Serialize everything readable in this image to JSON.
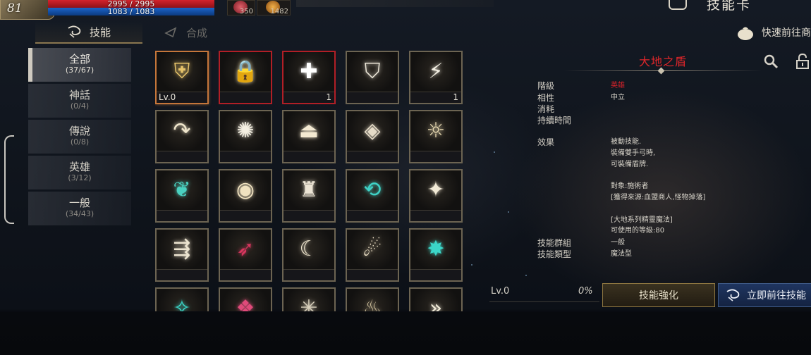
{
  "hud": {
    "level": "81",
    "hp_text": "2995 / 2995",
    "mp_text": "1083 / 1083",
    "potion_1_count": "350",
    "potion_2_count": "1482",
    "title": "技能卡"
  },
  "tabs": [
    {
      "label": "技能",
      "active": true
    },
    {
      "label": "合成",
      "active": false
    }
  ],
  "quick_link": "快速前往商",
  "categories": [
    {
      "name": "全部",
      "count": "(37/67)",
      "active": true
    },
    {
      "name": "神話",
      "count": "(0/4)",
      "active": false
    },
    {
      "name": "傳說",
      "count": "(0/8)",
      "active": false
    },
    {
      "name": "英雄",
      "count": "(3/12)",
      "active": false
    },
    {
      "name": "一般",
      "count": "(34/43)",
      "active": false
    }
  ],
  "skills": [
    {
      "icon": "shield-sword-icon",
      "glyph": "⛨",
      "color": "#e6c36a",
      "border": "selected",
      "lv": "Lv.0",
      "num": ""
    },
    {
      "icon": "lock-star-icon",
      "glyph": "🔒",
      "color": "#e8d8a8",
      "border": "red",
      "lv": "",
      "num": ""
    },
    {
      "icon": "swirl-plus-icon",
      "glyph": "✚",
      "color": "#ffffff",
      "border": "red",
      "lv": "",
      "num": "1"
    },
    {
      "icon": "shield-icon",
      "glyph": "⛉",
      "color": "#ece6d8",
      "border": "normal",
      "lv": "",
      "num": ""
    },
    {
      "icon": "lightning-icon",
      "glyph": "⚡",
      "color": "#f2eee2",
      "border": "normal",
      "lv": "",
      "num": "1"
    },
    {
      "icon": "curved-arrow-icon",
      "glyph": "↷",
      "color": "#f0e6cc",
      "border": "normal",
      "lv": "",
      "num": ""
    },
    {
      "icon": "burst-icon",
      "glyph": "✺",
      "color": "#f4efe2",
      "border": "normal",
      "lv": "",
      "num": ""
    },
    {
      "icon": "summon-circle-icon",
      "glyph": "⏏",
      "color": "#f4ead2",
      "border": "normal",
      "lv": "",
      "num": ""
    },
    {
      "icon": "eye-icon",
      "glyph": "◈",
      "color": "#e6dcc8",
      "border": "normal",
      "lv": "",
      "num": ""
    },
    {
      "icon": "wave-sun-icon",
      "glyph": "☼",
      "color": "#e6d8b0",
      "border": "normal",
      "lv": "",
      "num": ""
    },
    {
      "icon": "teal-leaf-icon",
      "glyph": "❦",
      "color": "#4ad1c0",
      "border": "normal",
      "lv": "",
      "num": ""
    },
    {
      "icon": "orb-icon",
      "glyph": "◉",
      "color": "#f0e2c0",
      "border": "normal",
      "lv": "",
      "num": ""
    },
    {
      "icon": "pillar-icon",
      "glyph": "♜",
      "color": "#ece4d4",
      "border": "normal",
      "lv": "",
      "num": ""
    },
    {
      "icon": "cycle-arrows-icon",
      "glyph": "⟲",
      "color": "#3fd2c6",
      "border": "normal",
      "lv": "",
      "num": ""
    },
    {
      "icon": "sparkle-ground-icon",
      "glyph": "✦",
      "color": "#f2ead6",
      "border": "normal",
      "lv": "",
      "num": ""
    },
    {
      "icon": "split-arrows-icon",
      "glyph": "⇶",
      "color": "#ece4d0",
      "border": "normal",
      "lv": "",
      "num": ""
    },
    {
      "icon": "bat-wing-icon",
      "glyph": "➶",
      "color": "#d8365e",
      "border": "normal",
      "lv": "",
      "num": ""
    },
    {
      "icon": "crescent-icon",
      "glyph": "☾",
      "color": "#f4ead2",
      "border": "normal",
      "lv": "",
      "num": ""
    },
    {
      "icon": "comet-icon",
      "glyph": "☄",
      "color": "#f4e8cc",
      "border": "normal",
      "lv": "",
      "num": ""
    },
    {
      "icon": "teal-star-icon",
      "glyph": "✸",
      "color": "#3bd6c8",
      "border": "normal",
      "lv": "",
      "num": ""
    },
    {
      "icon": "teal-sparkle-icon",
      "glyph": "✧",
      "color": "#3bd6c8",
      "border": "normal",
      "lv": "",
      "num": ""
    },
    {
      "icon": "pink-crystal-icon",
      "glyph": "❖",
      "color": "#e04a7a",
      "border": "normal",
      "lv": "",
      "num": ""
    },
    {
      "icon": "web-icon",
      "glyph": "✳",
      "color": "#d8d0bc",
      "border": "normal",
      "lv": "",
      "num": ""
    },
    {
      "icon": "flame-icon",
      "glyph": "♨",
      "color": "#e8d8b0",
      "border": "normal",
      "lv": "",
      "num": ""
    },
    {
      "icon": "chevrons-icon",
      "glyph": "»",
      "color": "#f0ead8",
      "border": "normal",
      "lv": "",
      "num": ""
    }
  ],
  "detail": {
    "name": "大地之盾",
    "rows": [
      {
        "key": "階級",
        "value": "英雄",
        "red": true
      },
      {
        "key": "相性",
        "value": "中立",
        "red": false
      },
      {
        "key": "消耗",
        "value": "",
        "red": false
      },
      {
        "key": "持續時間",
        "value": "",
        "red": false
      }
    ],
    "effect_key": "效果",
    "effect_text": "被動技能.\n裝備雙手弓時,\n可裝備盾牌.\n\n對象:施術者\n[獲得來源:血盟商人,怪物掉落]\n\n[大地系列精靈魔法]\n可使用的等級:80",
    "group_key": "技能群組",
    "group_value": "一般",
    "type_key": "技能類型",
    "type_value": "魔法型",
    "level": "Lv.0",
    "percent": "0%",
    "enhance_label": "技能強化",
    "goto_label": "立即前往技能"
  },
  "colors": {
    "accent_gold": "#8d7640",
    "rare_red": "#d8222a",
    "selected_orange": "#c5763a",
    "goto_blue": "#1f3560"
  }
}
